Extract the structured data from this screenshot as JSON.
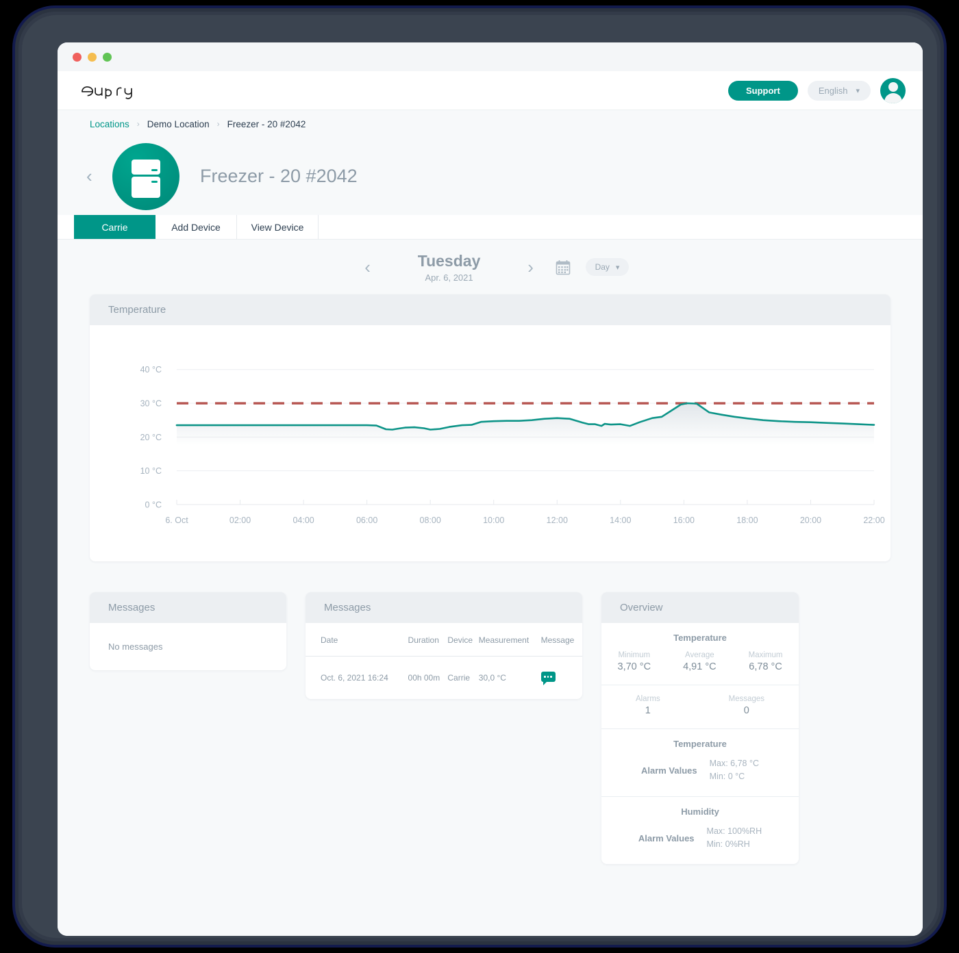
{
  "window": {
    "traffic_lights": [
      "close",
      "minimize",
      "maximize"
    ]
  },
  "header": {
    "logo_text": "eupry",
    "support_label": "Support",
    "language": "English",
    "avatar_name": "user-avatar"
  },
  "breadcrumb": {
    "items": [
      {
        "label": "Locations",
        "type": "link"
      },
      {
        "label": "Demo Location",
        "type": "link"
      },
      {
        "label": "Freezer - 20 #2042",
        "type": "current"
      }
    ],
    "separator": "›"
  },
  "page": {
    "back_arrow": "‹",
    "title": "Freezer - 20 #2042",
    "device_icon": "freezer-icon"
  },
  "tabs": [
    {
      "label": "Carrie",
      "active": true
    },
    {
      "label": "Add Device",
      "active": false
    },
    {
      "label": "View Device",
      "active": false
    }
  ],
  "date_nav": {
    "prev": "‹",
    "next": "›",
    "weekday": "Tuesday",
    "date": "Apr. 6, 2021",
    "calendar_icon": "calendar-icon",
    "period": "Day",
    "period_chevron": "⌄"
  },
  "chart_card": {
    "title": "Temperature"
  },
  "chart_data": {
    "type": "line",
    "title": "Temperature",
    "xlabel": "",
    "ylabel": "",
    "ylim": [
      0,
      44
    ],
    "yticks": [
      0,
      10,
      20,
      30,
      40
    ],
    "ytick_labels": [
      "0 °C",
      "10 °C",
      "20 °C",
      "30 °C",
      "40 °C"
    ],
    "xticks": [
      0,
      2,
      4,
      6,
      8,
      10,
      12,
      14,
      16,
      18,
      20,
      22
    ],
    "xtick_labels": [
      "6. Oct",
      "02:00",
      "04:00",
      "06:00",
      "08:00",
      "10:00",
      "12:00",
      "14:00",
      "16:00",
      "18:00",
      "20:00",
      "22:00"
    ],
    "grid": true,
    "legend": "none",
    "series": [
      {
        "name": "Temperature",
        "color": "#0d9488",
        "style": "solid",
        "x": [
          0,
          0.5,
          1,
          1.5,
          2,
          2.5,
          3,
          3.5,
          4,
          4.5,
          5,
          5.5,
          6,
          6.3,
          6.6,
          6.8,
          7.0,
          7.2,
          7.5,
          7.8,
          8.0,
          8.3,
          8.6,
          9.0,
          9.3,
          9.6,
          10.0,
          10.4,
          10.8,
          11.2,
          11.6,
          12.0,
          12.4,
          12.8,
          13.0,
          13.2,
          13.4,
          13.5,
          13.7,
          14.0,
          14.3,
          14.6,
          15.0,
          15.3,
          15.6,
          15.9,
          16.1,
          16.4,
          16.8,
          17.2,
          17.6,
          18.0,
          18.5,
          19.0,
          19.5,
          20.0,
          20.5,
          21.0,
          21.5,
          22.0
        ],
        "y": [
          23.5,
          23.5,
          23.5,
          23.5,
          23.5,
          23.5,
          23.5,
          23.5,
          23.5,
          23.5,
          23.5,
          23.5,
          23.5,
          23.4,
          22.3,
          22.2,
          22.5,
          22.8,
          22.9,
          22.6,
          22.2,
          22.4,
          23.0,
          23.5,
          23.6,
          24.5,
          24.7,
          24.8,
          24.8,
          25.0,
          25.4,
          25.6,
          25.4,
          24.3,
          23.8,
          23.8,
          23.3,
          23.9,
          23.7,
          23.8,
          23.3,
          24.4,
          25.6,
          26.0,
          27.8,
          29.6,
          30.0,
          29.9,
          27.3,
          26.6,
          26.0,
          25.5,
          25.0,
          24.7,
          24.5,
          24.4,
          24.2,
          24.0,
          23.8,
          23.6
        ]
      },
      {
        "name": "Alarm threshold",
        "color": "#b5534f",
        "style": "dashed",
        "value": 30
      }
    ]
  },
  "messages_left": {
    "title": "Messages",
    "empty_text": "No messages"
  },
  "messages_right": {
    "title": "Messages",
    "columns": [
      "Date",
      "Duration",
      "Device",
      "Measurement",
      "Message"
    ],
    "rows": [
      {
        "date": "Oct. 6, 2021 16:24",
        "duration": "00h 00m",
        "device": "Carrie",
        "measurement": "30,0 °C",
        "message_icon": "message-bubble-icon"
      }
    ]
  },
  "overview": {
    "title": "Overview",
    "temperature": {
      "heading": "Temperature",
      "stats": [
        {
          "label": "Minimum",
          "value": "3,70 °C"
        },
        {
          "label": "Average",
          "value": "4,91 °C"
        },
        {
          "label": "Maximum",
          "value": "6,78 °C"
        }
      ]
    },
    "counts": [
      {
        "label": "Alarms",
        "value": "1"
      },
      {
        "label": "Messages",
        "value": "0"
      }
    ],
    "temperature_alarm": {
      "heading": "Temperature",
      "label": "Alarm Values",
      "max": "Max: 6,78 °C",
      "min": "Min: 0 °C"
    },
    "humidity_alarm": {
      "heading": "Humidity",
      "label": "Alarm Values",
      "max": "Max: 100%RH",
      "min": "Min: 0%RH"
    }
  },
  "colors": {
    "accent": "#009688",
    "chart_line": "#0d9488",
    "alarm_line": "#b5534f",
    "page_bg": "#f7f9fa",
    "text_muted": "#8d9ba7"
  }
}
